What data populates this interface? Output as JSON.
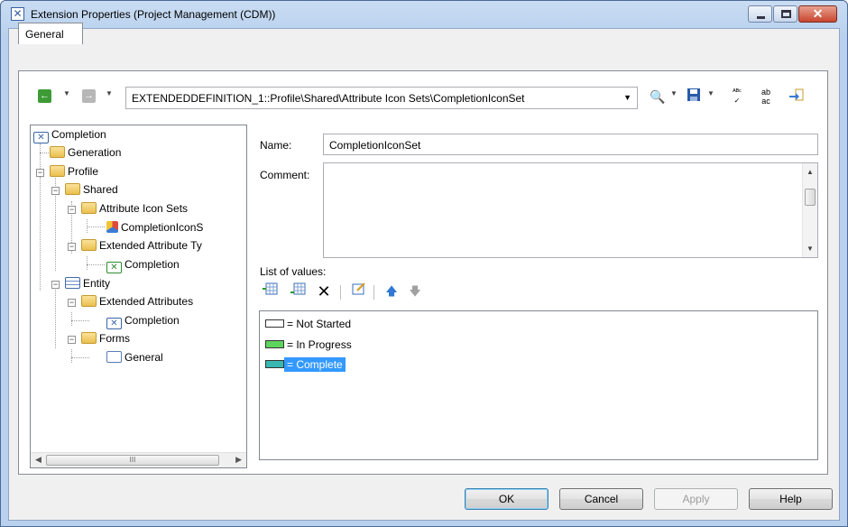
{
  "window": {
    "title": "Extension Properties (Project Management (CDM))",
    "close_glyph": "✕"
  },
  "tabs": [
    {
      "label": "General"
    }
  ],
  "toolbar": {
    "path": "EXTENDEDDEFINITION_1::Profile\\Shared\\Attribute Icon Sets\\CompletionIconSet",
    "back_glyph": "←",
    "forward_glyph": "→",
    "icons": [
      "find-icon",
      "save-icon",
      "spellcheck-icon",
      "replace-icon",
      "import-icon"
    ]
  },
  "tree": {
    "items": [
      {
        "label": "Completion",
        "icon": "extension-icon"
      },
      {
        "label": "Generation",
        "icon": "folder-icon"
      },
      {
        "label": "Profile",
        "icon": "folder-icon"
      },
      {
        "label": "Shared",
        "icon": "folder-icon"
      },
      {
        "label": "Attribute Icon Sets",
        "icon": "folder-icon"
      },
      {
        "label": "CompletionIconS",
        "icon": "icon-set-icon"
      },
      {
        "label": "Extended Attribute Ty",
        "icon": "folder-icon"
      },
      {
        "label": "Completion",
        "icon": "extended-attribute-type-icon"
      },
      {
        "label": "Entity",
        "icon": "entity-icon"
      },
      {
        "label": "Extended Attributes",
        "icon": "folder-icon"
      },
      {
        "label": "Completion",
        "icon": "extended-attribute-icon"
      },
      {
        "label": "Forms",
        "icon": "folder-icon"
      },
      {
        "label": "General",
        "icon": "form-icon"
      }
    ],
    "scroll_thumb_glyph": "III"
  },
  "form": {
    "name_label": "Name:",
    "name_value": "CompletionIconSet",
    "comment_label": "Comment:",
    "comment_value": "",
    "list_label": "List of values:"
  },
  "values": [
    {
      "text": "= Not Started",
      "color": "#ffffff"
    },
    {
      "text": "= In Progress",
      "color": "#5ed45e"
    },
    {
      "text": "= Complete",
      "color": "#38b8b0",
      "selected": true
    }
  ],
  "buttons": {
    "ok": "OK",
    "cancel": "Cancel",
    "apply": "Apply",
    "help": "Help"
  }
}
